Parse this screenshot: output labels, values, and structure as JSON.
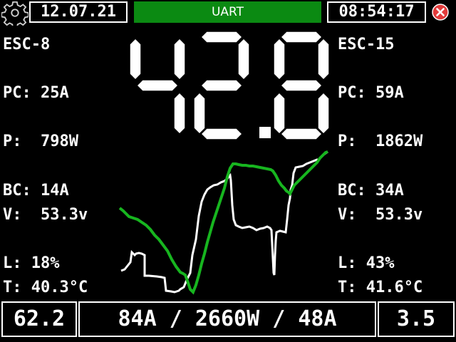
{
  "header": {
    "date": "12.07.21",
    "mode": "UART",
    "time": "08:54:17",
    "icons": {
      "settings": "gear-icon",
      "close": "close-icon"
    },
    "colors": {
      "mode_bg": "#0b8a12",
      "close": "#e23b3b"
    }
  },
  "main_value": "42.8",
  "left": {
    "name": "ESC-8",
    "pc": "PC: 25A",
    "p": "P:  798W",
    "bc": "BC: 14A",
    "v": "V:  53.3v",
    "l": "L: 18%",
    "t": "T: 40.3°C"
  },
  "right": {
    "name": "ESC-15",
    "pc": "PC: 59A",
    "p": "P:  1862W",
    "bc": "BC: 34A",
    "v": "V:  53.3v",
    "l": "L: 43%",
    "t": "T: 41.6°C"
  },
  "bottom": {
    "left": "62.2",
    "center": "84A / 2660W / 48A",
    "right": "3.5"
  },
  "graph": {
    "colors": {
      "white_trace": "#ffffff",
      "green_trace": "#17b51f"
    }
  }
}
